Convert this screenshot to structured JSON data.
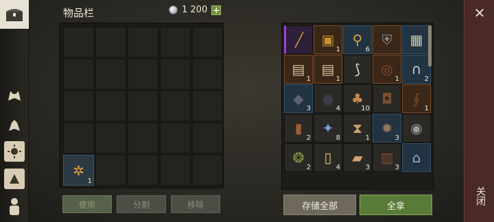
{
  "header": {
    "title": "物品栏",
    "currency_amount": "1 200",
    "add_label": "+"
  },
  "left_grid": {
    "slot_count": 25,
    "items": [
      {
        "row": 4,
        "col": 0,
        "icon": "seeds-icon",
        "count": "1"
      }
    ]
  },
  "left_buttons": {
    "use": "使用",
    "split": "分割",
    "remove": "移除"
  },
  "right_grid": {
    "items": [
      {
        "icon": "spear-icon",
        "count": "",
        "rarity": "purple"
      },
      {
        "icon": "book-icon",
        "count": "1",
        "rarity": "orange"
      },
      {
        "icon": "broom-icon",
        "count": "6",
        "rarity": "blue"
      },
      {
        "icon": "armor-icon",
        "count": "",
        "rarity": "orange"
      },
      {
        "icon": "blueprint-icon",
        "count": "",
        "rarity": "blue"
      },
      {
        "icon": "scroll-map-icon",
        "count": "1",
        "rarity": "orange"
      },
      {
        "icon": "scroll-map-icon",
        "count": "1",
        "rarity": "orange"
      },
      {
        "icon": "saber-icon",
        "count": "",
        "rarity": "normal"
      },
      {
        "icon": "belt-icon",
        "count": "1",
        "rarity": "orange"
      },
      {
        "icon": "shackle-icon",
        "count": "2",
        "rarity": "blue"
      },
      {
        "icon": "ore-icon",
        "count": "3",
        "rarity": "blue"
      },
      {
        "icon": "coal-icon",
        "count": "4",
        "rarity": "normal"
      },
      {
        "icon": "sack-icon",
        "count": "10",
        "rarity": "normal"
      },
      {
        "icon": "bag-icon",
        "count": "",
        "rarity": "normal"
      },
      {
        "icon": "whip-icon",
        "count": "1",
        "rarity": "orange"
      },
      {
        "icon": "flask-icon",
        "count": "2",
        "rarity": "normal"
      },
      {
        "icon": "crystal-icon",
        "count": "8",
        "rarity": "normal"
      },
      {
        "icon": "hourglass-icon",
        "count": "1",
        "rarity": "normal"
      },
      {
        "icon": "trap-icon",
        "count": "3",
        "rarity": "blue"
      },
      {
        "icon": "shield-icon",
        "count": "",
        "rarity": "normal"
      },
      {
        "icon": "yarn-icon",
        "count": "2",
        "rarity": "normal"
      },
      {
        "icon": "candle-icon",
        "count": "4",
        "rarity": "normal"
      },
      {
        "icon": "cloth-icon",
        "count": "3",
        "rarity": "normal"
      },
      {
        "icon": "barrel-icon",
        "count": "3",
        "rarity": "normal"
      },
      {
        "icon": "boots-icon",
        "count": "",
        "rarity": "blue"
      }
    ]
  },
  "right_buttons": {
    "store_all": "存储全部",
    "take_all": "全拿"
  },
  "close_label": "关闭",
  "left_bar_icons": [
    "chest-icon",
    "wolf-icon",
    "dog-icon",
    "sun-icon",
    "map-icon",
    "character-icon"
  ],
  "colors": {
    "take_all": "#5a7a38",
    "close_panel": "#4a2a26",
    "purple_rarity": "#a33ce0"
  }
}
